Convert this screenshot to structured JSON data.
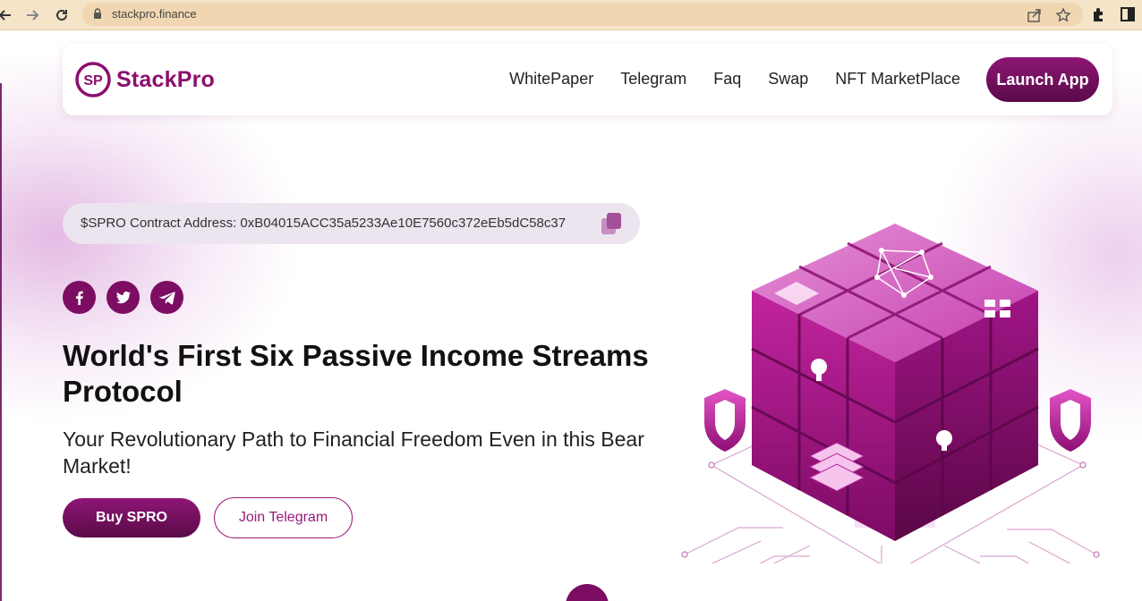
{
  "browser": {
    "url": "stackpro.finance",
    "icons": [
      "back-icon",
      "forward-icon",
      "reload-icon",
      "lock-icon",
      "share-icon",
      "star-icon",
      "extensions-icon",
      "sidebar-icon"
    ]
  },
  "nav": {
    "logo_text": "StackPro",
    "logo_mark": "SP",
    "links": [
      "WhitePaper",
      "Telegram",
      "Faq",
      "Swap",
      "NFT MarketPlace"
    ],
    "launch_label": "Launch App"
  },
  "contract": {
    "text": "$SPRO Contract Address: 0xB04015ACC35a5233Ae10E7560c372eEb5dC58c37"
  },
  "socials": [
    "facebook-icon",
    "twitter-icon",
    "telegram-icon"
  ],
  "hero": {
    "title": "World's First Six Passive Income Streams Protocol",
    "subtitle": "Your Revolutionary Path to Financial Freedom Even in this Bear Market!",
    "buy_label": "Buy SPRO",
    "telegram_label": "Join Telegram"
  },
  "colors": {
    "brand": "#8c0f6f",
    "brand_dark": "#5a0a49",
    "chrome_bg": "#f5e4c8"
  }
}
